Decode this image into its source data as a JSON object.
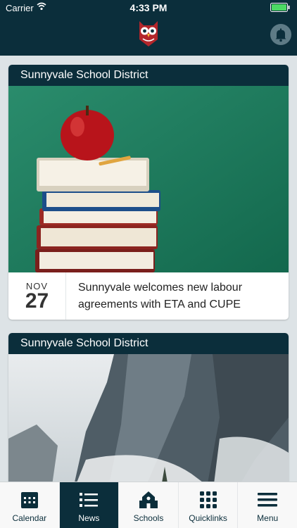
{
  "status_bar": {
    "carrier": "Carrier",
    "time": "4:33 PM"
  },
  "header": {
    "logo_icon": "owl-logo-icon",
    "bell_icon": "bell-icon"
  },
  "feed": [
    {
      "source": "Sunnyvale School District",
      "image": "apple-on-books",
      "month": "NOV",
      "day": "27",
      "headline": "Sunnyvale welcomes new labour agreements with ETA and CUPE"
    },
    {
      "source": "Sunnyvale School District",
      "image": "snowy-mountain"
    }
  ],
  "tabs": [
    {
      "label": "Calendar",
      "icon": "calendar-icon",
      "active": false
    },
    {
      "label": "News",
      "icon": "list-icon",
      "active": true
    },
    {
      "label": "Schools",
      "icon": "school-icon",
      "active": false
    },
    {
      "label": "Quicklinks",
      "icon": "grid-icon",
      "active": false
    },
    {
      "label": "Menu",
      "icon": "hamburger-icon",
      "active": false
    }
  ],
  "colors": {
    "brand": "#0b2e3b",
    "background": "#dde3e6"
  }
}
